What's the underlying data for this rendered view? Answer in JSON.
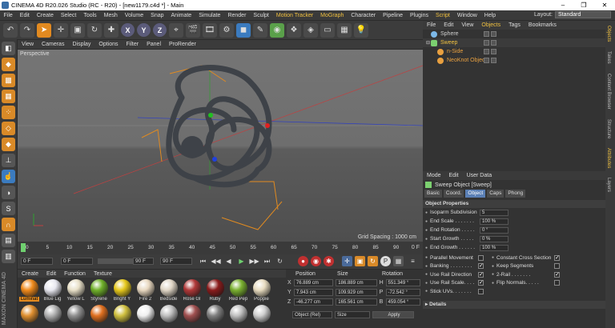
{
  "window": {
    "title": "CINEMA 4D R20.026 Studio (RC - R20) - [new1179.c4d *] - Main",
    "controls": [
      "–",
      "❐",
      "✕"
    ]
  },
  "menu": [
    "File",
    "Edit",
    "Create",
    "Select",
    "Tools",
    "Mesh",
    "Volume",
    "Snap",
    "Animate",
    "Simulate",
    "Render",
    "Sculpt",
    "Motion Tracker",
    "MoGraph",
    "Character",
    "Pipeline",
    "Plugins",
    "Script",
    "Window",
    "Help"
  ],
  "layout": {
    "label": "Layout:",
    "value": "Standard"
  },
  "viewport": {
    "menu": [
      "View",
      "Cameras",
      "Display",
      "Options",
      "Filter",
      "Panel",
      "ProRender"
    ],
    "camera": "Perspective",
    "grid_spacing": "Grid Spacing : 1000 cm"
  },
  "timeline": {
    "ticks": [
      "0",
      "5",
      "10",
      "15",
      "20",
      "25",
      "30",
      "35",
      "40",
      "45",
      "50",
      "55",
      "60",
      "65",
      "70",
      "75",
      "80",
      "85",
      "90"
    ],
    "end_label": "0 F"
  },
  "transport": {
    "start": "0 F",
    "current": "0 F",
    "end": "90 F",
    "end2": "90 F"
  },
  "materials": {
    "menu": [
      "Create",
      "Edit",
      "Function",
      "Texture"
    ],
    "row1": [
      {
        "name": "Luminat",
        "color": "#f08a1c"
      },
      {
        "name": "Blue Lig",
        "color": "#e8e8f0"
      },
      {
        "name": "Yellow L",
        "color": "#e8e0c8"
      },
      {
        "name": "Styrene",
        "color": "#6fb02a"
      },
      {
        "name": "Bright Y",
        "color": "#e6c81c"
      },
      {
        "name": "Fire 2",
        "color": "#e8d8c0"
      },
      {
        "name": "Bedside",
        "color": "#e0d6c6"
      },
      {
        "name": "Rose Gl",
        "color": "#b03838"
      },
      {
        "name": "Ruby",
        "color": "#8a1c1c"
      },
      {
        "name": "Red Pep",
        "color": "#7ab030"
      },
      {
        "name": "Poppie",
        "color": "#e8dcc0"
      }
    ],
    "row2_colors": [
      "#e09030",
      "#b0b0b0",
      "#909090",
      "#e07020",
      "#d0c040",
      "#f0f0f0",
      "#c0c0c0",
      "#a05050",
      "#808080",
      "#c0c0c0",
      "#d0d0d0"
    ]
  },
  "coords": {
    "headers": [
      "Position",
      "Size",
      "Rotation"
    ],
    "rows": [
      {
        "axis": "X",
        "pos": "76.889 cm",
        "size": "186.889 cm",
        "rot_axis": "H",
        "rot": "551.349 °"
      },
      {
        "axis": "Y",
        "pos": "7.943 cm",
        "size": "109.929 cm",
        "rot_axis": "P",
        "rot": "-72.542 °"
      },
      {
        "axis": "Z",
        "pos": "-46.277 cm",
        "size": "165.561 cm",
        "rot_axis": "B",
        "rot": "459.054 °"
      }
    ],
    "mode1": "Object (Rel)",
    "mode2": "Size",
    "apply": "Apply"
  },
  "objects": {
    "menu": [
      "File",
      "Edit",
      "View",
      "Objects",
      "Tags",
      "Bookmarks"
    ],
    "items": [
      {
        "name": "Sphere",
        "color": "#7cb8e8",
        "indent": 0
      },
      {
        "name": "Sweep",
        "color": "#7cd070",
        "indent": 0
      },
      {
        "name": "n-Side",
        "color": "#e8a040",
        "indent": 1
      },
      {
        "name": "NeoKnot Object",
        "color": "#e8a040",
        "indent": 1
      }
    ]
  },
  "attributes": {
    "menu": [
      "Mode",
      "Edit",
      "User Data"
    ],
    "title": "Sweep Object [Sweep]",
    "tabs": [
      "Basic",
      "Coord.",
      "Object",
      "Caps",
      "Phong"
    ],
    "section": "Object Properties",
    "props": [
      {
        "label": "Isoparm Subdivision",
        "value": "5"
      },
      {
        "label": "End Scale . . . . . . .",
        "value": "100 %"
      },
      {
        "label": "End Rotation . . . . .",
        "value": "0 °"
      },
      {
        "label": "Start Growth . . . . .",
        "value": "0 %"
      },
      {
        "label": "End Growth . . . . . .",
        "value": "100 %"
      }
    ],
    "checks_left": [
      {
        "label": "Parallel Movement",
        "checked": false
      },
      {
        "label": "Banking . . . . . . . .",
        "checked": true
      },
      {
        "label": "Use Rail Direction",
        "checked": true
      },
      {
        "label": "Use Rail Scale. . . .",
        "checked": true
      },
      {
        "label": "Stick UVs. . . . . . .",
        "checked": false
      }
    ],
    "checks_right": [
      {
        "label": "Constant Cross Section",
        "checked": true
      },
      {
        "label": "Keep Segments",
        "checked": false
      },
      {
        "label": "2-Rail . . . . . . .",
        "checked": true
      },
      {
        "label": "Flip Normals. . . . .",
        "checked": false
      }
    ],
    "details": "Details"
  },
  "right_tabs": [
    "Objects",
    "Takes",
    "Content Browser",
    "Structure",
    "Attributes",
    "Layers"
  ],
  "brand": "MAXON CINEMA 4D"
}
